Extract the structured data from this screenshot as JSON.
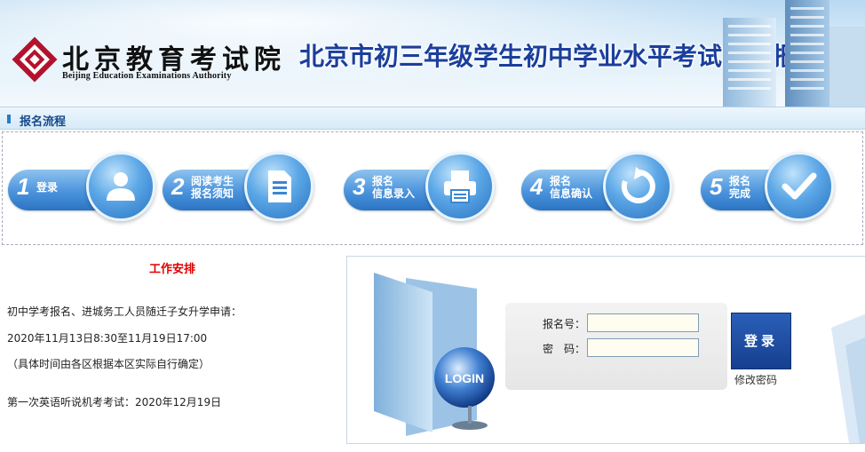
{
  "header": {
    "logo_cn": "北京教育考试院",
    "logo_en": "Beijing Education Examinations Authority",
    "site_title": "北京市初三年级学生初中学业水平考试网上报名"
  },
  "section": {
    "title": "报名流程"
  },
  "steps": [
    {
      "num": "1",
      "label_line1": "登录",
      "label_line2": "",
      "icon": "user-icon"
    },
    {
      "num": "2",
      "label_line1": "阅读考生",
      "label_line2": "报名须知",
      "icon": "document-icon"
    },
    {
      "num": "3",
      "label_line1": "报名",
      "label_line2": "信息录入",
      "icon": "printer-icon"
    },
    {
      "num": "4",
      "label_line1": "报名",
      "label_line2": "信息确认",
      "icon": "refresh-icon"
    },
    {
      "num": "5",
      "label_line1": "报名",
      "label_line2": "完成",
      "icon": "checkmark-icon"
    }
  ],
  "notice": {
    "title": "工作安排",
    "line1": "初中学考报名、进城务工人员随迁子女升学申请：",
    "line2": "2020年11月13日8:30至11月19日17:00",
    "line3": "（具体时间由各区根据本区实际自行确定）",
    "line4": "第一次英语听说机考考试：2020年12月19日"
  },
  "login": {
    "username_label": "报名号：",
    "username_value": "",
    "password_label": "密　码：",
    "password_value": "",
    "login_button": "登录",
    "change_password": "修改密码",
    "folder_badge": "LOGIN"
  },
  "colors": {
    "title_blue": "#1a3f9c",
    "step_blue": "#4a93dc",
    "notice_red": "#e00000",
    "button_blue": "#1e4fa3"
  }
}
